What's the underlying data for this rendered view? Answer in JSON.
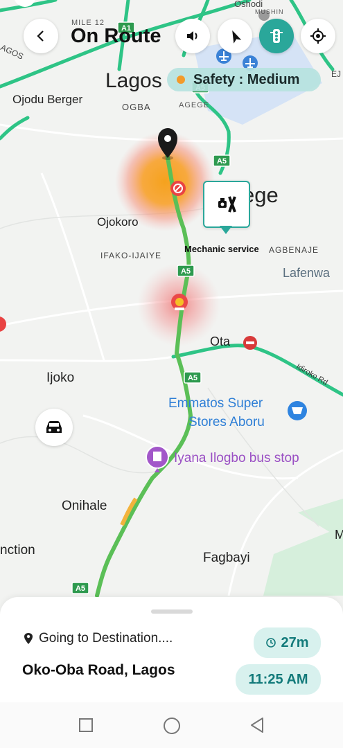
{
  "header": {
    "title": "On Route",
    "back_icon": "chevron-left-icon",
    "sound_icon": "speaker-icon",
    "compass_icon": "compass-icon",
    "traffic_icon": "traffic-light-icon",
    "locate_icon": "crosshair-icon"
  },
  "safety": {
    "label": "Safety : Medium",
    "level": "Medium",
    "dot_color": "#f39a2a"
  },
  "map": {
    "labels": {
      "mile12": "MILE 12",
      "agos": "AGOS",
      "lagos": "Lagos",
      "ojodu": "Ojodu Berger",
      "ogba": "OGBA",
      "agege_small": "AGEGE",
      "agege_big": "ege",
      "ojokoro": "Ojokoro",
      "ifako": "IFAKO-IJAIYE",
      "agbenaje": "AGBENAJE",
      "lafenwa": "Lafenwa",
      "ota": "Ota",
      "idiroko": "Idiroko Rd",
      "ijoko": "Ijoko",
      "emmatos1": "Emmatos Super",
      "emmatos2": "Stores Aboru",
      "iyana": "Iyana Ilogbo bus stop",
      "onihale": "Onihale",
      "junction": "nction",
      "fagbayi": "Fagbayi",
      "osbodi": "Oshodi",
      "mushin": "MUSHIN",
      "ej": "EJ",
      "m": "M"
    },
    "road_shields": [
      "A1",
      "A5",
      "A5",
      "A5",
      "A5",
      "A5"
    ],
    "mechanic_label": "Mechanic service",
    "mechanic_icon": "mechanic-tools-icon",
    "car_icon": "car-icon",
    "colors": {
      "route": "#5bbf57",
      "road": "#2ec486",
      "hazard_orange": "#f79b1f",
      "hazard_red": "#e94a4a",
      "water": "#d0e0f7"
    }
  },
  "sheet": {
    "going_label": "Going to Destination....",
    "destination": "Oko-Oba Road, Lagos",
    "duration": "27m",
    "eta": "11:25 AM",
    "pin_icon": "location-pin-icon",
    "clock_icon": "clock-icon"
  },
  "navbar": {
    "recent_icon": "square-icon",
    "home_icon": "circle-icon",
    "back_icon": "triangle-back-icon"
  }
}
